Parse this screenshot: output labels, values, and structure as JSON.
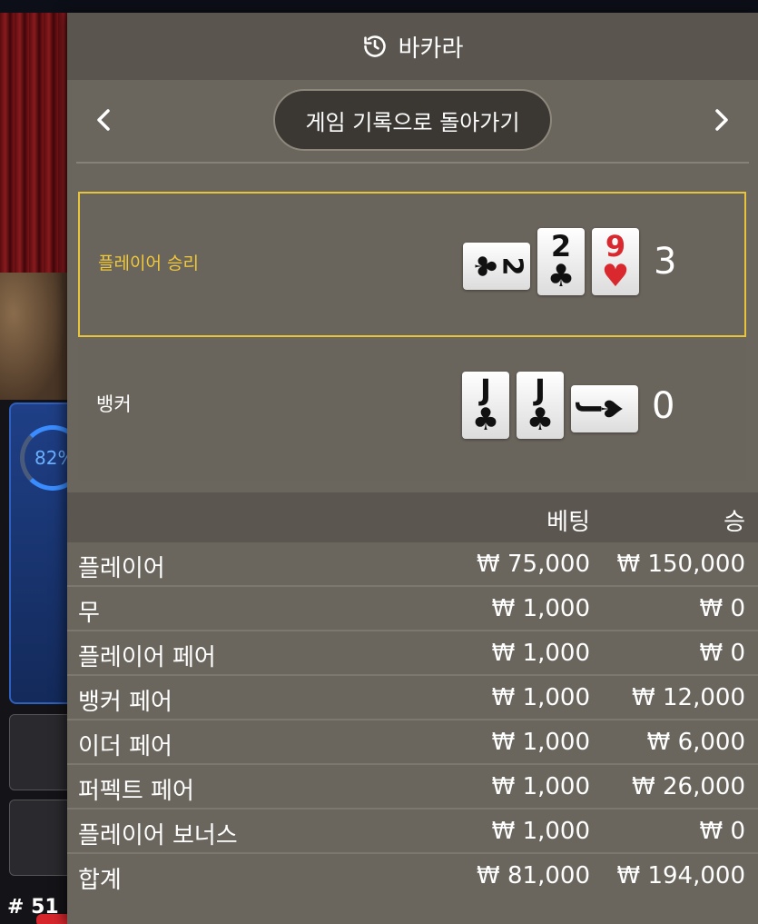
{
  "background": {
    "progress_percent": "82%",
    "round_label": "# 51"
  },
  "header": {
    "title": "바카라",
    "icon": "history-icon"
  },
  "nav": {
    "back_label": "게임 기록으로 돌아가기",
    "prev_icon": "chevron-left-icon",
    "next_icon": "chevron-right-icon"
  },
  "result": {
    "player": {
      "label": "플레이어 승리",
      "score": "3",
      "cards": [
        {
          "rank": "2",
          "suit": "♣",
          "color": "black",
          "orientation": "horizontal"
        },
        {
          "rank": "2",
          "suit": "♣",
          "color": "black",
          "orientation": "vertical"
        },
        {
          "rank": "9",
          "suit": "♥",
          "color": "red",
          "orientation": "vertical"
        }
      ]
    },
    "banker": {
      "label": "뱅커",
      "score": "0",
      "cards": [
        {
          "rank": "J",
          "suit": "♣",
          "color": "black",
          "orientation": "vertical"
        },
        {
          "rank": "J",
          "suit": "♣",
          "color": "black",
          "orientation": "vertical"
        },
        {
          "rank": "J",
          "suit": "♠",
          "color": "black",
          "orientation": "horizontal"
        }
      ]
    }
  },
  "bets": {
    "headers": {
      "bet": "베팅",
      "win": "승"
    },
    "rows": [
      {
        "name": "플레이어",
        "bet": "₩ 75,000",
        "win": "₩ 150,000"
      },
      {
        "name": "무",
        "bet": "₩ 1,000",
        "win": "₩ 0"
      },
      {
        "name": "플레이어 페어",
        "bet": "₩ 1,000",
        "win": "₩ 0"
      },
      {
        "name": "뱅커 페어",
        "bet": "₩ 1,000",
        "win": "₩ 12,000"
      },
      {
        "name": "이더 페어",
        "bet": "₩ 1,000",
        "win": "₩ 6,000"
      },
      {
        "name": "퍼펙트 페어",
        "bet": "₩ 1,000",
        "win": "₩ 26,000"
      },
      {
        "name": "플레이어 보너스",
        "bet": "₩ 1,000",
        "win": "₩ 0"
      }
    ],
    "total": {
      "name": "합계",
      "bet": "₩ 81,000",
      "win": "₩ 194,000"
    }
  },
  "colors": {
    "winner_border": "#e7c43a",
    "red_suit": "#d9282e",
    "panel_bg": "#6b665d"
  }
}
